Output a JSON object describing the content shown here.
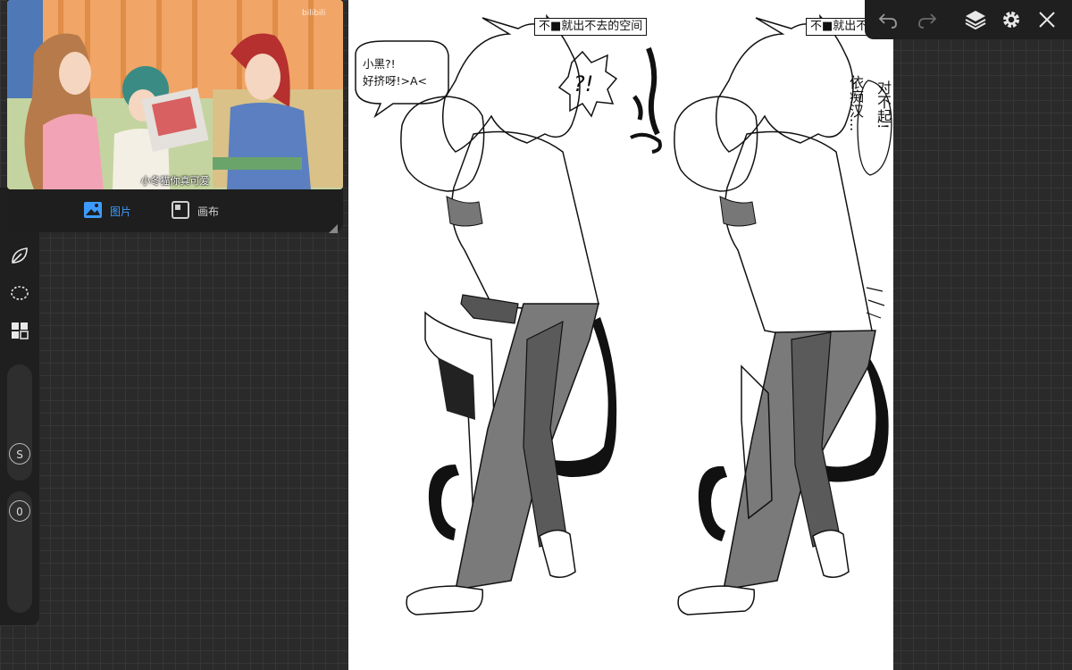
{
  "reference": {
    "subtitle": "小冬猫你真可爱",
    "watermark": "bilibili",
    "tabs": [
      {
        "label": "图片",
        "active": true,
        "icon": "image-icon"
      },
      {
        "label": "画布",
        "active": false,
        "icon": "canvas-icon"
      }
    ]
  },
  "artwork": {
    "titles": [
      "不■就出不去的空间",
      "不■就出不去的空间"
    ],
    "speech": [
      "小黑?!",
      "好挤呀!>A<"
    ],
    "exclaim": "?!",
    "apology_a": "依痴汉...",
    "apology_b": "对不起!"
  },
  "toolbar": {
    "tools": [
      "brush-icon",
      "smudge-icon",
      "selection-lasso-icon",
      "quickmenu-grid-icon"
    ],
    "size_slider": {
      "knob_label": "S"
    },
    "opacity_slider": {
      "knob_label": "0"
    }
  },
  "topbar": {
    "buttons": [
      "undo-icon",
      "redo-icon",
      "layers-icon",
      "settings-icon",
      "close-icon"
    ]
  },
  "colors": {
    "accent": "#3d9bff",
    "background": "#2a2a2a",
    "panel": "#1f1f1f"
  }
}
